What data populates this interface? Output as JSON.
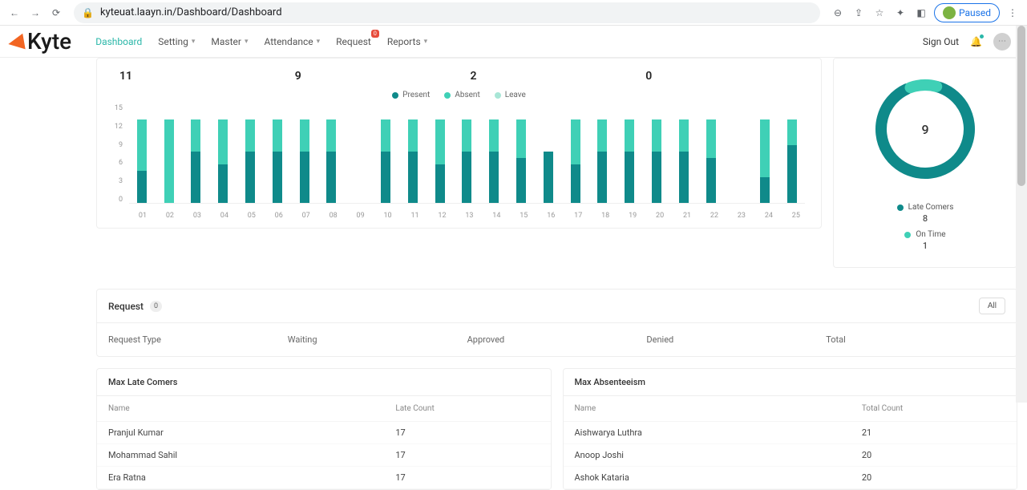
{
  "browser": {
    "url": "kyteuat.laayn.in/Dashboard/Dashboard",
    "paused": "Paused"
  },
  "logo": "Kyte",
  "nav": {
    "items": [
      "Dashboard",
      "Setting",
      "Master",
      "Attendance",
      "Request",
      "Reports"
    ],
    "active": 0,
    "request_badge": "0",
    "sign_out": "Sign Out"
  },
  "stats": {
    "a": "11",
    "b": "9",
    "c": "2",
    "d": "0"
  },
  "chart_data": {
    "type": "bar",
    "legend": [
      {
        "name": "Present",
        "color": "#0f8a8a"
      },
      {
        "name": "Absent",
        "color": "#3fd0b6"
      },
      {
        "name": "Leave",
        "color": "#a8e6d6"
      }
    ],
    "y_ticks": [
      15,
      12,
      9,
      6,
      3,
      0
    ],
    "ylim": [
      0,
      15
    ],
    "categories": [
      "01",
      "02",
      "03",
      "04",
      "05",
      "06",
      "07",
      "08",
      "09",
      "10",
      "11",
      "12",
      "13",
      "14",
      "15",
      "16",
      "17",
      "18",
      "19",
      "20",
      "21",
      "22",
      "23",
      "24",
      "25"
    ],
    "series": [
      {
        "name": "Present",
        "color": "#0f8a8a",
        "values": [
          5,
          0,
          8,
          6,
          8,
          8,
          8,
          8,
          0,
          8,
          8,
          6,
          8,
          8,
          7,
          8,
          6,
          8,
          8,
          8,
          8,
          7,
          0,
          4,
          9
        ]
      },
      {
        "name": "Absent",
        "color": "#3fd0b6",
        "values": [
          8,
          13,
          5,
          7,
          5,
          5,
          5,
          5,
          0,
          5,
          5,
          7,
          5,
          5,
          6,
          0,
          7,
          5,
          5,
          5,
          5,
          6,
          0,
          9,
          4
        ]
      },
      {
        "name": "Leave",
        "color": "#a8e6d6",
        "values": [
          0,
          0,
          0,
          0,
          0,
          0,
          0,
          0,
          0,
          0,
          0,
          0,
          0,
          0,
          0,
          0,
          0,
          0,
          0,
          0,
          0,
          0,
          0,
          0,
          0
        ]
      }
    ]
  },
  "donut": {
    "center": "9",
    "legend": [
      {
        "label": "Late Comers",
        "color": "#0f8a8a",
        "value": "8"
      },
      {
        "label": "On Time",
        "color": "#3fd0b6",
        "value": "1"
      }
    ]
  },
  "request": {
    "title": "Request",
    "count": "0",
    "all": "All",
    "headers": [
      "Request Type",
      "Waiting",
      "Approved",
      "Denied",
      "Total"
    ]
  },
  "late_comers": {
    "title": "Max Late Comers",
    "headers": [
      "Name",
      "Late Count"
    ],
    "rows": [
      {
        "name": "Pranjul Kumar",
        "val": "17"
      },
      {
        "name": "Mohammad Sahil",
        "val": "17"
      },
      {
        "name": "Era Ratna",
        "val": "17"
      }
    ]
  },
  "absenteeism": {
    "title": "Max Absenteeism",
    "headers": [
      "Name",
      "Total Count"
    ],
    "rows": [
      {
        "name": "Aishwarya Luthra",
        "val": "21"
      },
      {
        "name": "Anoop Joshi",
        "val": "20"
      },
      {
        "name": "Ashok Kataria",
        "val": "20"
      }
    ]
  }
}
